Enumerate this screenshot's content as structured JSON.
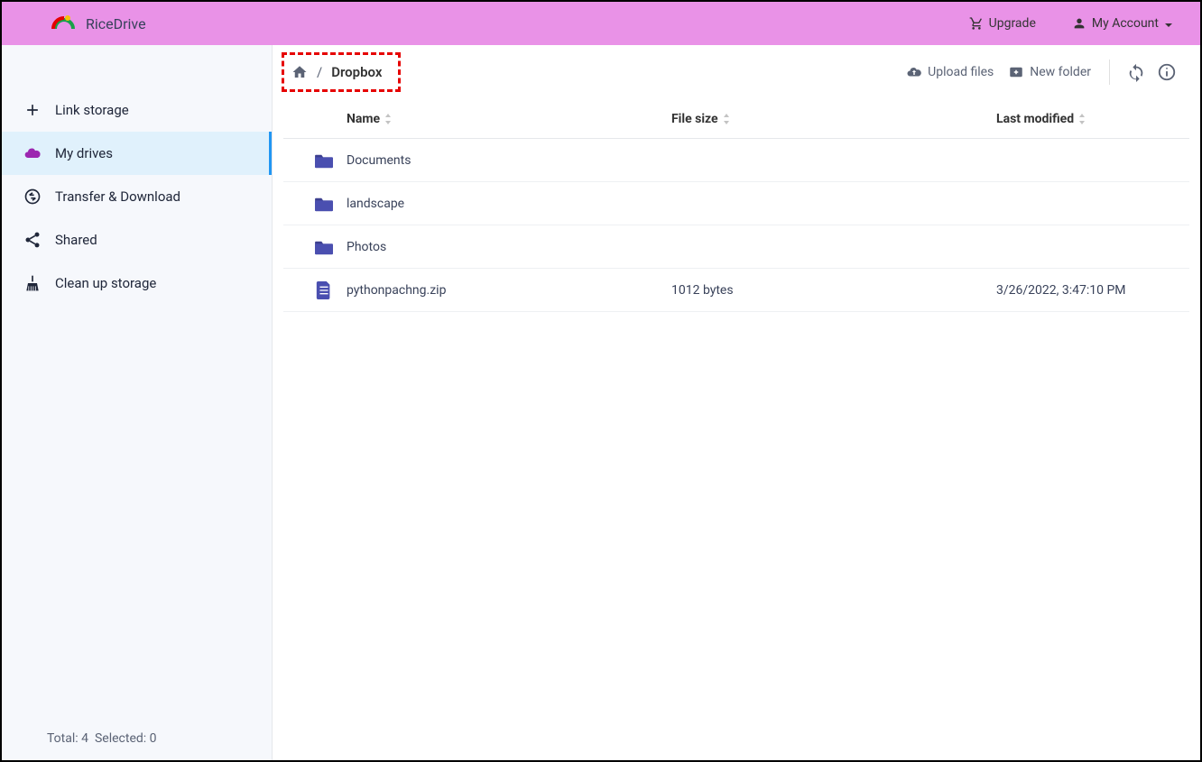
{
  "brand": {
    "name": "RiceDrive"
  },
  "header": {
    "upgrade": "Upgrade",
    "account": "My Account"
  },
  "sidebar": {
    "items": [
      {
        "id": "link-storage",
        "label": "Link storage",
        "icon": "plus-icon",
        "active": false
      },
      {
        "id": "my-drives",
        "label": "My drives",
        "icon": "cloud-icon",
        "active": true
      },
      {
        "id": "transfer-download",
        "label": "Transfer & Download",
        "icon": "transfer-icon",
        "active": false
      },
      {
        "id": "shared",
        "label": "Shared",
        "icon": "share-icon",
        "active": false
      },
      {
        "id": "clean-up",
        "label": "Clean up storage",
        "icon": "broom-icon",
        "active": false
      }
    ],
    "footer": {
      "total_label": "Total:",
      "total_value": "4",
      "selected_label": "Selected:",
      "selected_value": "0"
    }
  },
  "breadcrumb": {
    "separator": "/",
    "current": "Dropbox"
  },
  "toolbar": {
    "upload": "Upload files",
    "new_folder": "New folder"
  },
  "table": {
    "columns": {
      "name": "Name",
      "size": "File size",
      "modified": "Last modified"
    },
    "rows": [
      {
        "type": "folder",
        "name": "Documents",
        "size": "",
        "modified": ""
      },
      {
        "type": "folder",
        "name": "landscape",
        "size": "",
        "modified": ""
      },
      {
        "type": "folder",
        "name": "Photos",
        "size": "",
        "modified": ""
      },
      {
        "type": "file",
        "name": "pythonpachng.zip",
        "size": "1012 bytes",
        "modified": "3/26/2022, 3:47:10 PM"
      }
    ]
  },
  "colors": {
    "header_bg": "#e992e7",
    "sidebar_bg": "#f6f8fc",
    "active_bg": "#e0f1fc",
    "active_border": "#2196f3",
    "folder_fill": "#3c3f8f",
    "highlight_border": "#e60000"
  }
}
